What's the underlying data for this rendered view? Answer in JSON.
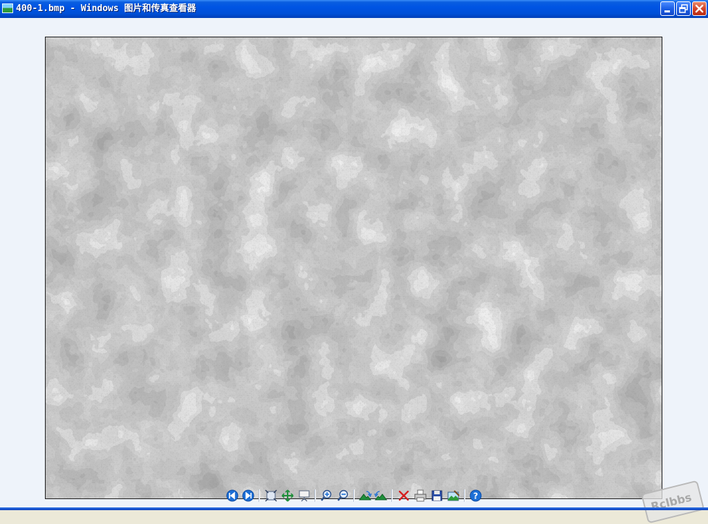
{
  "window": {
    "title": "400-1.bmp - Windows 图片和传真查看器"
  },
  "image": {
    "description_icon": "photo-icon"
  },
  "toolbar": {
    "buttons": [
      {
        "name": "previous-image-button",
        "icon": "previous-icon"
      },
      {
        "name": "next-image-button",
        "icon": "next-icon"
      },
      {
        "name": "best-fit-button",
        "icon": "best-fit-icon"
      },
      {
        "name": "actual-size-button",
        "icon": "actual-size-icon"
      },
      {
        "name": "slideshow-button",
        "icon": "slideshow-icon"
      },
      {
        "name": "zoom-in-button",
        "icon": "zoom-in-icon"
      },
      {
        "name": "zoom-out-button",
        "icon": "zoom-out-icon"
      },
      {
        "name": "rotate-clockwise-button",
        "icon": "rotate-cw-icon"
      },
      {
        "name": "rotate-counterclockwise-button",
        "icon": "rotate-ccw-icon"
      },
      {
        "name": "delete-button",
        "icon": "delete-icon"
      },
      {
        "name": "print-button",
        "icon": "print-icon"
      },
      {
        "name": "save-button",
        "icon": "save-icon"
      },
      {
        "name": "open-editor-button",
        "icon": "edit-icon"
      },
      {
        "name": "help-button",
        "icon": "help-icon"
      }
    ]
  },
  "watermark": {
    "text": "Rclbbs"
  },
  "colors": {
    "titlebar": "#0054e3",
    "viewport": "#eef3fa",
    "nav_blue": "#1c6fd6",
    "delete_red": "#d42020"
  }
}
